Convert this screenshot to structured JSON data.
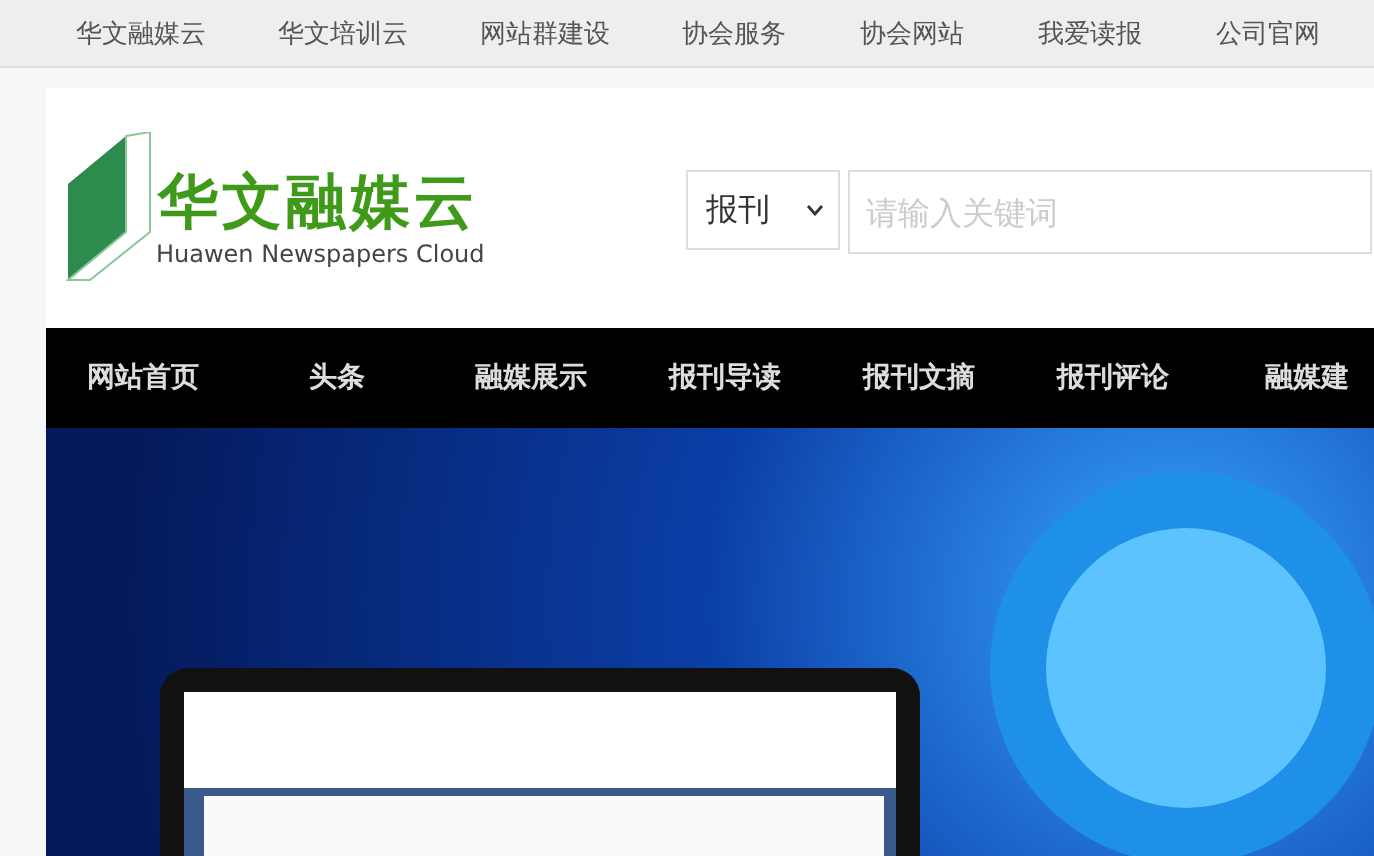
{
  "top_links": [
    "华文融媒云",
    "华文培训云",
    "网站群建设",
    "协会服务",
    "协会网站",
    "我爱读报",
    "公司官网"
  ],
  "logo": {
    "title": "华文融媒云",
    "subtitle": "Huawen Newspapers Cloud"
  },
  "search": {
    "category": "报刊",
    "placeholder": "请输入关键词"
  },
  "nav": [
    "网站首页",
    "头条",
    "融媒展示",
    "报刊导读",
    "报刊文摘",
    "报刊评论",
    "融媒建"
  ]
}
